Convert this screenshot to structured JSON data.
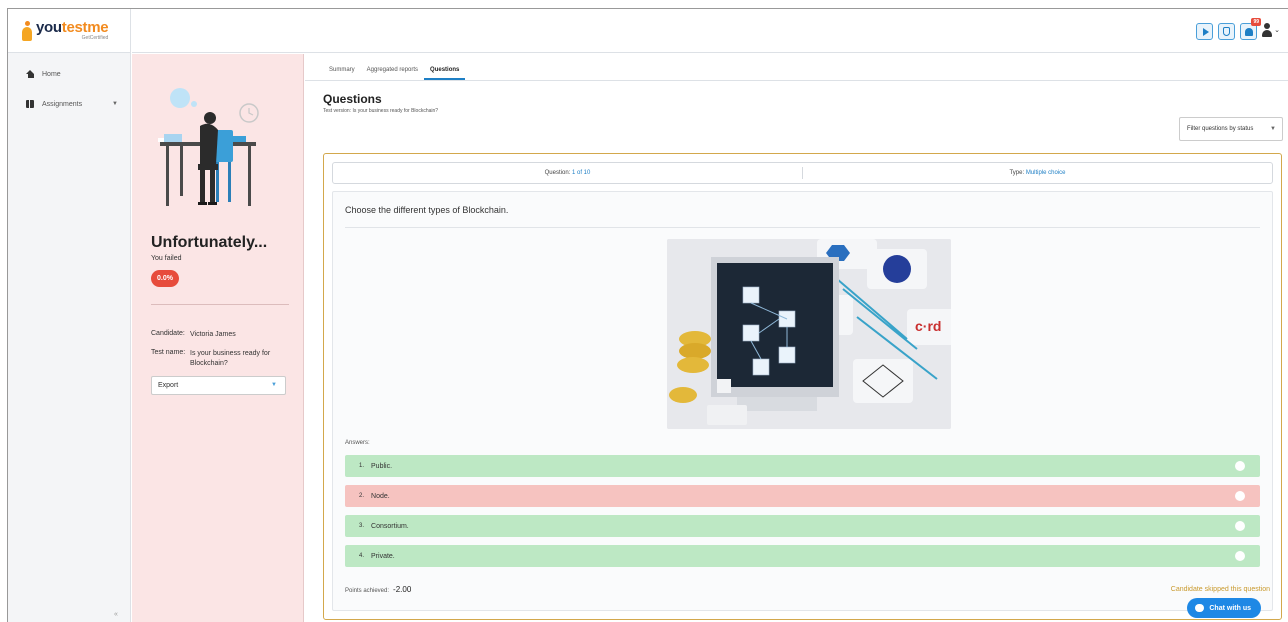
{
  "brand": {
    "name_part1": "you",
    "name_part2": "testme",
    "tagline": "GetCertified"
  },
  "sidebar": {
    "items": [
      {
        "label": "Home",
        "icon": "home-icon"
      },
      {
        "label": "Assignments",
        "icon": "assignments-icon",
        "has_submenu": true
      }
    ],
    "collapse_label": "«"
  },
  "topbar": {
    "notification_count": "99"
  },
  "result": {
    "title": "Unfortunately...",
    "subtitle": "You failed",
    "score": "0.0%",
    "candidate_label": "Candidate:",
    "candidate_value": "Victoria James",
    "test_name_label": "Test name:",
    "test_name_value": "Is your business ready for Blockchain?",
    "export_label": "Export"
  },
  "tabs": [
    {
      "label": "Summary",
      "active": false
    },
    {
      "label": "Aggregated reports",
      "active": false
    },
    {
      "label": "Questions",
      "active": true
    }
  ],
  "questions": {
    "heading": "Questions",
    "version": "Test version: Is your business ready for Blockchain?",
    "filter_label": "Filter questions by status",
    "info": {
      "question_label": "Question:",
      "question_value": "1 of 10",
      "type_label": "Type:",
      "type_value": "Multiple choice"
    },
    "text": "Choose the different types of Blockchain.",
    "answers_label": "Answers:",
    "answers": [
      {
        "num": "1.",
        "text": "Public.",
        "status": "correct"
      },
      {
        "num": "2.",
        "text": "Node.",
        "status": "wrong"
      },
      {
        "num": "3.",
        "text": "Consortium.",
        "status": "correct"
      },
      {
        "num": "4.",
        "text": "Private.",
        "status": "correct"
      }
    ],
    "points_label": "Points achieved:",
    "points_value": "-2.00",
    "skipped_text": "Candidate skipped this question"
  },
  "chat": {
    "label": "Chat with us"
  },
  "colors": {
    "accent": "#1e7fc5",
    "fail": "#e74c3c",
    "correct": "#bde8c4",
    "wrong": "#f6c3c0",
    "brand": "#f28b1f"
  }
}
